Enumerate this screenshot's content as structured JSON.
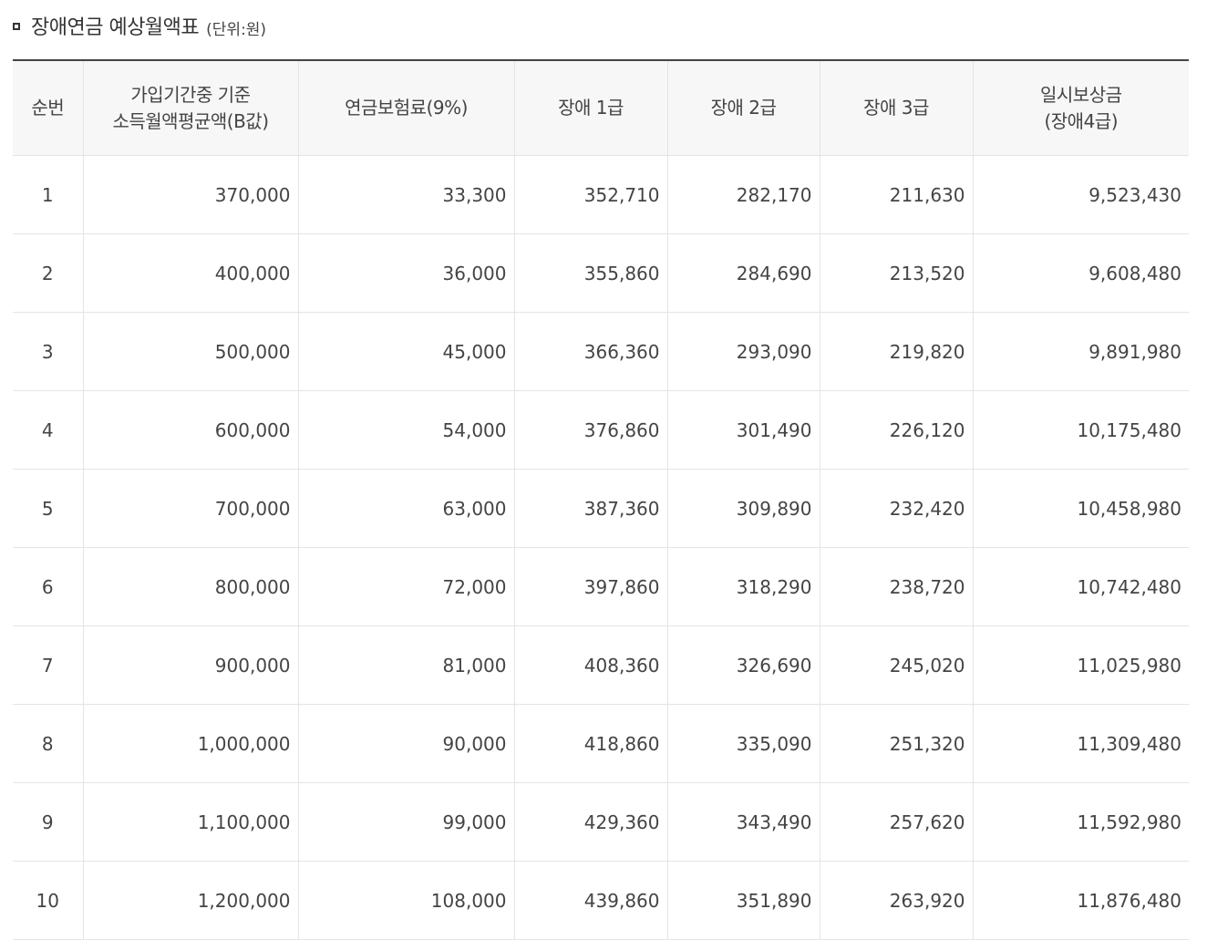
{
  "title": {
    "main": "장애연금 예상월액표",
    "unit": "(단위:원)"
  },
  "table": {
    "headers": [
      {
        "line1": "순번",
        "line2": ""
      },
      {
        "line1": "가입기간중 기준",
        "line2": "소득월액평균액(B값)"
      },
      {
        "line1": "연금보험료(9%)",
        "line2": ""
      },
      {
        "line1": "장애 1급",
        "line2": ""
      },
      {
        "line1": "장애 2급",
        "line2": ""
      },
      {
        "line1": "장애 3급",
        "line2": ""
      },
      {
        "line1": "일시보상금",
        "line2": "(장애4급)"
      }
    ],
    "rows": [
      [
        "1",
        "370,000",
        "33,300",
        "352,710",
        "282,170",
        "211,630",
        "9,523,430"
      ],
      [
        "2",
        "400,000",
        "36,000",
        "355,860",
        "284,690",
        "213,520",
        "9,608,480"
      ],
      [
        "3",
        "500,000",
        "45,000",
        "366,360",
        "293,090",
        "219,820",
        "9,891,980"
      ],
      [
        "4",
        "600,000",
        "54,000",
        "376,860",
        "301,490",
        "226,120",
        "10,175,480"
      ],
      [
        "5",
        "700,000",
        "63,000",
        "387,360",
        "309,890",
        "232,420",
        "10,458,980"
      ],
      [
        "6",
        "800,000",
        "72,000",
        "397,860",
        "318,290",
        "238,720",
        "10,742,480"
      ],
      [
        "7",
        "900,000",
        "81,000",
        "408,360",
        "326,690",
        "245,020",
        "11,025,980"
      ],
      [
        "8",
        "1,000,000",
        "90,000",
        "418,860",
        "335,090",
        "251,320",
        "11,309,480"
      ],
      [
        "9",
        "1,100,000",
        "99,000",
        "429,360",
        "343,490",
        "257,620",
        "11,592,980"
      ],
      [
        "10",
        "1,200,000",
        "108,000",
        "439,860",
        "351,890",
        "263,920",
        "11,876,480"
      ]
    ]
  }
}
